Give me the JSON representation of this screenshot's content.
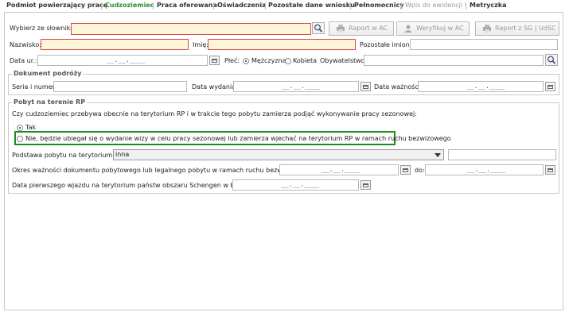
{
  "tabs": [
    {
      "label": "Podmiot powierzający pracę",
      "state": "normal"
    },
    {
      "label": "Cudzoziemiec",
      "state": "active"
    },
    {
      "label": "Praca oferowana",
      "state": "normal"
    },
    {
      "label": "Oświadczenia",
      "state": "normal"
    },
    {
      "label": "Pozostałe dane wniosku",
      "state": "normal"
    },
    {
      "label": "Pełnomocnicy",
      "state": "normal"
    },
    {
      "label": "Wpis do ewidencji",
      "state": "disabled"
    },
    {
      "label": "Metryczka",
      "state": "normal"
    }
  ],
  "top": {
    "dictionary_label": "Wybierz ze słownika:",
    "dictionary_value": "",
    "raport_ac_label": "Raport w AC",
    "weryfikuj_ac_label": "Weryfikuj w AC",
    "raport_sg_label": "Raport z SG | UdSC"
  },
  "person": {
    "surname_label": "Nazwisko:",
    "surname_value": "",
    "firstname_label": "Imię:",
    "firstname_value": "",
    "othernames_label": "Pozostałe imiona:",
    "othernames_value": "",
    "birthdate_label": "Data ur.:",
    "birthdate_mask": "__.__.____",
    "sex_label": "Płeć:",
    "sex_male_label": "Mężczyzna",
    "sex_female_label": "Kobieta",
    "sex_selected": "male",
    "citizenship_label": "Obywatelstwo:",
    "citizenship_value": ""
  },
  "travel_doc": {
    "title": "Dokument podróży",
    "series_label": "Seria i numer:",
    "series_value": "",
    "issue_label": "Data wydania:",
    "issue_mask": "__.__.____",
    "expiry_label": "Data ważności:",
    "expiry_mask": "__.__.____"
  },
  "stay": {
    "title": "Pobyt na terenie RP",
    "question": "Czy cudzoziemiec przebywa obecnie na terytorium RP i w trakcie tego pobytu zamierza podjąć wykonywanie pracy sezonowej:",
    "option_yes": "Tak",
    "option_no": "Nie, będzie ubiegał się o wydanie wizy w celu pracy sezonowej lub zamierza wjechać na terytorium RP w ramach ruchu bezwizowego",
    "selected": "yes",
    "basis_label": "Podstawa pobytu na terytorium RP:",
    "basis_value": "inna",
    "basis_extra": "",
    "validity_label": "Okres ważności dokumentu pobytowego lub legalnego pobytu w ramach ruchu bezwizowego od:",
    "validity_from_mask": "__.__.____",
    "validity_to_label": "do:",
    "validity_to_mask": "__.__.____",
    "schengen_label": "Data pierwszego wjazdu na terytorium państw obszaru Schengen w bież. roku:",
    "schengen_mask": "__.__.____"
  },
  "colors": {
    "accent": "#2e8b2e",
    "required_bg": "#fff6d9",
    "required_border": "#d84a4a",
    "highlight": "#1e8a1e"
  }
}
